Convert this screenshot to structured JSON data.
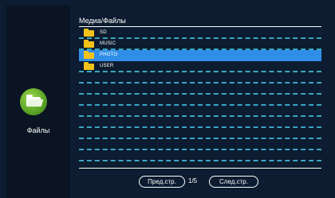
{
  "sidebar": {
    "label": "Файлы",
    "icon": "folder-open-icon"
  },
  "header": {
    "breadcrumb": "Медиа/Файлы"
  },
  "list": {
    "items": [
      {
        "label": "SD",
        "icon": "folder-icon",
        "selected": false
      },
      {
        "label": "MUSIC",
        "icon": "folder-icon",
        "selected": false
      },
      {
        "label": "PHOTO",
        "icon": "folder-icon",
        "selected": true
      },
      {
        "label": "USER",
        "icon": "folder-icon",
        "selected": false
      },
      {
        "label": "",
        "icon": "",
        "selected": false
      },
      {
        "label": "",
        "icon": "",
        "selected": false
      },
      {
        "label": "",
        "icon": "",
        "selected": false
      },
      {
        "label": "",
        "icon": "",
        "selected": false
      },
      {
        "label": "",
        "icon": "",
        "selected": false
      },
      {
        "label": "",
        "icon": "",
        "selected": false
      },
      {
        "label": "",
        "icon": "",
        "selected": false
      },
      {
        "label": "",
        "icon": "",
        "selected": false
      }
    ]
  },
  "pager": {
    "prev_label": "Пред.стр.",
    "next_label": "След.стр.",
    "page": "1/5"
  },
  "colors": {
    "accent": "#2f8fe8",
    "background": "#0d1c30",
    "dash": "#3aa7c2",
    "folder": "#f2c21b",
    "icon_green": "#5fb02a"
  }
}
